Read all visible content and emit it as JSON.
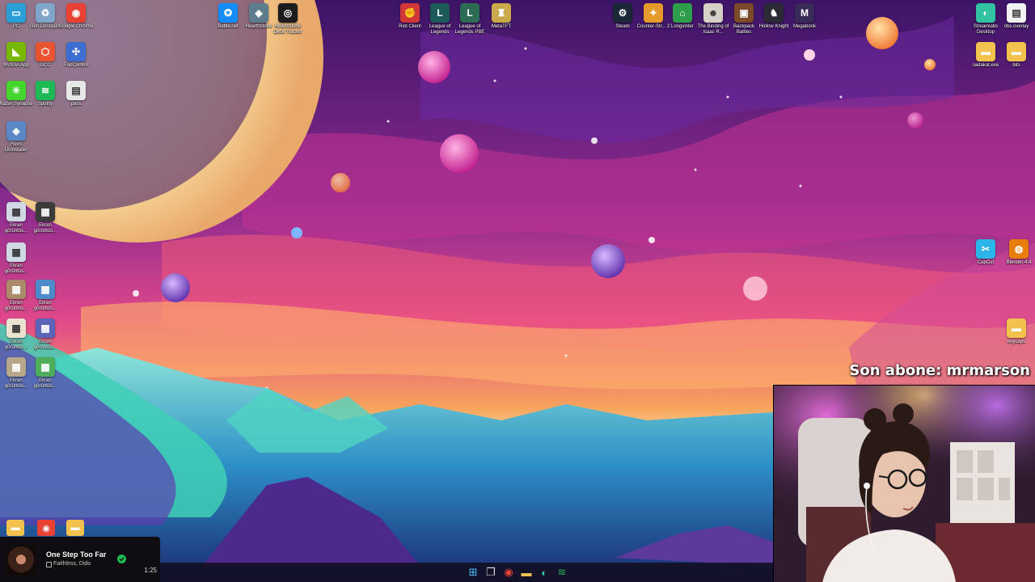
{
  "desktop": {
    "left_icons": [
      {
        "label": "PC",
        "icon": "monitor-icon",
        "color": "#2a9fd6"
      },
      {
        "label": "Geri Dönüşüm",
        "icon": "recycle-bin-icon",
        "color": "#7fa6c9"
      },
      {
        "label": "Google Chrome",
        "icon": "chrome-icon",
        "color": "#e94235"
      },
      {
        "label": "NVIDIA App",
        "icon": "nvidia-icon",
        "color": "#76b900"
      },
      {
        "label": "GCC",
        "icon": "gcc-icon",
        "color": "#e8542f"
      },
      {
        "label": "FanControl",
        "icon": "fan-icon",
        "color": "#3c6fd1"
      },
      {
        "label": "Razer Synapse",
        "icon": "razer-icon",
        "color": "#44d62c"
      },
      {
        "label": "Spotify",
        "icon": "spotify-icon",
        "color": "#1db954"
      },
      {
        "label": "pass",
        "icon": "document-icon",
        "color": "#e6e6e6"
      },
      {
        "label": "Revo Uninstaller",
        "icon": "revo-icon",
        "color": "#5a87c5"
      },
      {
        "label": "Ekran görüntüs...",
        "icon": "screenshot-icon",
        "color": "#cfd8e3"
      },
      {
        "label": "Ekran görüntüs...",
        "icon": "screenshot-icon",
        "color": "#3b3b3b"
      },
      {
        "label": "Ekran görüntüs...",
        "icon": "screenshot-icon",
        "color": "#cfd8e3"
      },
      {
        "label": "Ekran görüntüs...",
        "icon": "screenshot-icon",
        "color": "#a98a6a"
      },
      {
        "label": "Ekran görüntüs...",
        "icon": "screenshot-icon",
        "color": "#4d8ac9"
      },
      {
        "label": "Ekran görüntüs...",
        "icon": "screenshot-icon",
        "color": "#e9e3d0"
      },
      {
        "label": "Ekran görüntüs...",
        "icon": "screenshot-icon",
        "color": "#5c64b8"
      },
      {
        "label": "Ekran görüntüs...",
        "icon": "screenshot-icon",
        "color": "#b7a88b"
      },
      {
        "label": "Ekran görüntüs...",
        "icon": "screenshot-icon",
        "color": "#4fae5c"
      }
    ],
    "top_icons": [
      {
        "label": "Battle.net",
        "icon": "battlenet-icon",
        "color": "#148eff"
      },
      {
        "label": "Hearthstone",
        "icon": "hearthstone-icon",
        "color": "#5d7d8c"
      },
      {
        "label": "Hearthstone Deck Tracker",
        "icon": "deck-tracker-icon",
        "color": "#1c1c1c"
      },
      {
        "label": "Riot Client",
        "icon": "riot-icon",
        "color": "#d13639"
      },
      {
        "label": "League of Legends",
        "icon": "league-icon",
        "color": "#1e5a5a"
      },
      {
        "label": "League of Legends PBE",
        "icon": "league-pbe-icon",
        "color": "#2c6b54"
      },
      {
        "label": "MetaTFT",
        "icon": "metatft-icon",
        "color": "#c9a94a"
      },
      {
        "label": "Steam",
        "icon": "steam-icon",
        "color": "#1b2838"
      },
      {
        "label": "Counter-Str... 2",
        "icon": "cs2-icon",
        "color": "#e59a2b"
      },
      {
        "label": "Longvinter",
        "icon": "longvinter-icon",
        "color": "#2f9e4b"
      },
      {
        "label": "The Binding of Isaac R...",
        "icon": "isaac-icon",
        "color": "#d7d0c8"
      },
      {
        "label": "Backpack Battles",
        "icon": "backpack-icon",
        "color": "#7a4a2a"
      },
      {
        "label": "Hollow Knight",
        "icon": "hollow-knight-icon",
        "color": "#2a2a34"
      },
      {
        "label": "Megabonk",
        "icon": "megabonk-icon",
        "color": "#3a2a5a"
      }
    ],
    "right_icons": [
      {
        "label": "Streamlabs Desktop",
        "icon": "streamlabs-icon",
        "color": "#31c3a2"
      },
      {
        "label": "obs.overlay",
        "icon": "document-icon",
        "color": "#f2f2f2"
      },
      {
        "label": "sadakat.exe",
        "icon": "folder-icon",
        "color": "#f2c14e"
      },
      {
        "label": "bits",
        "icon": "folder-icon",
        "color": "#f2c14e"
      },
      {
        "label": "CapCut",
        "icon": "capcut-icon",
        "color": "#2bb5e8"
      },
      {
        "label": "Blender 4.4",
        "icon": "blender-icon",
        "color": "#e87d0d"
      },
      {
        "label": "keycaps",
        "icon": "folder-icon",
        "color": "#f2c14e"
      }
    ],
    "pinned_bottom": [
      {
        "icon": "folder-icon",
        "color": "#f2c14e"
      },
      {
        "icon": "chrome-icon",
        "color": "#e94235"
      },
      {
        "icon": "folder-icon",
        "color": "#f2c14e"
      }
    ]
  },
  "overlay": {
    "subscriber_text": "Son abone: mrmarson"
  },
  "spotify_widget": {
    "track": "One Step Too Far (",
    "artist": "Faithless, Dido",
    "time": "1:25",
    "liked": true
  },
  "taskbar": {
    "items": [
      {
        "icon": "windows-start-icon",
        "color": "#4cc2ff"
      },
      {
        "icon": "task-view-icon",
        "color": "#e0e0e0"
      },
      {
        "icon": "chrome-icon",
        "color": "#e94235"
      },
      {
        "icon": "file-explorer-icon",
        "color": "#f2c14e"
      },
      {
        "icon": "streamlabs-icon",
        "color": "#31c3a2"
      },
      {
        "icon": "spotify-icon",
        "color": "#1db954"
      }
    ]
  }
}
